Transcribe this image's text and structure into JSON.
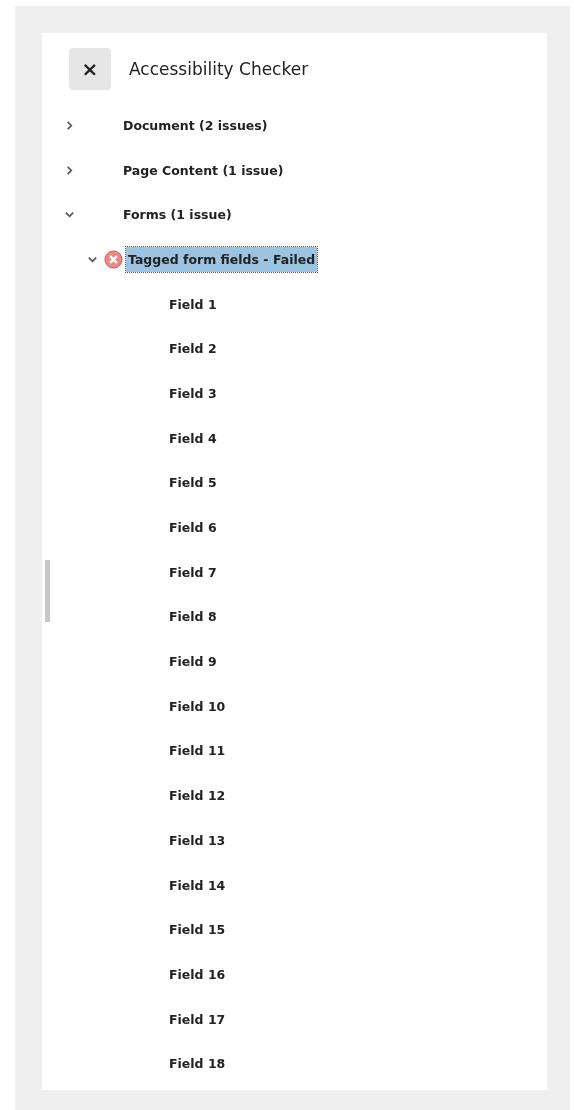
{
  "panel": {
    "close": "×",
    "title": "Accessibility Checker"
  },
  "tree": [
    {
      "label": "Document (2 issues)",
      "expanded": false
    },
    {
      "label": "Page Content (1 issue)",
      "expanded": false
    },
    {
      "label": "Forms (1 issue)",
      "expanded": true,
      "children": [
        {
          "label": "Tagged form fields - Failed",
          "expanded": true,
          "selected": true,
          "kind": "failed",
          "children": [
            {
              "label": "Field 1"
            },
            {
              "label": "Field 2"
            },
            {
              "label": "Field 3"
            },
            {
              "label": "Field 4"
            },
            {
              "label": "Field 5"
            },
            {
              "label": "Field 6"
            },
            {
              "label": "Field 7"
            },
            {
              "label": "Field 8"
            },
            {
              "label": "Field 9"
            },
            {
              "label": "Field 10"
            },
            {
              "label": "Field 11"
            },
            {
              "label": "Field 12"
            },
            {
              "label": "Field 13"
            },
            {
              "label": "Field 14"
            },
            {
              "label": "Field 15"
            },
            {
              "label": "Field 16"
            },
            {
              "label": "Field 17"
            },
            {
              "label": "Field 18"
            }
          ]
        }
      ]
    }
  ]
}
